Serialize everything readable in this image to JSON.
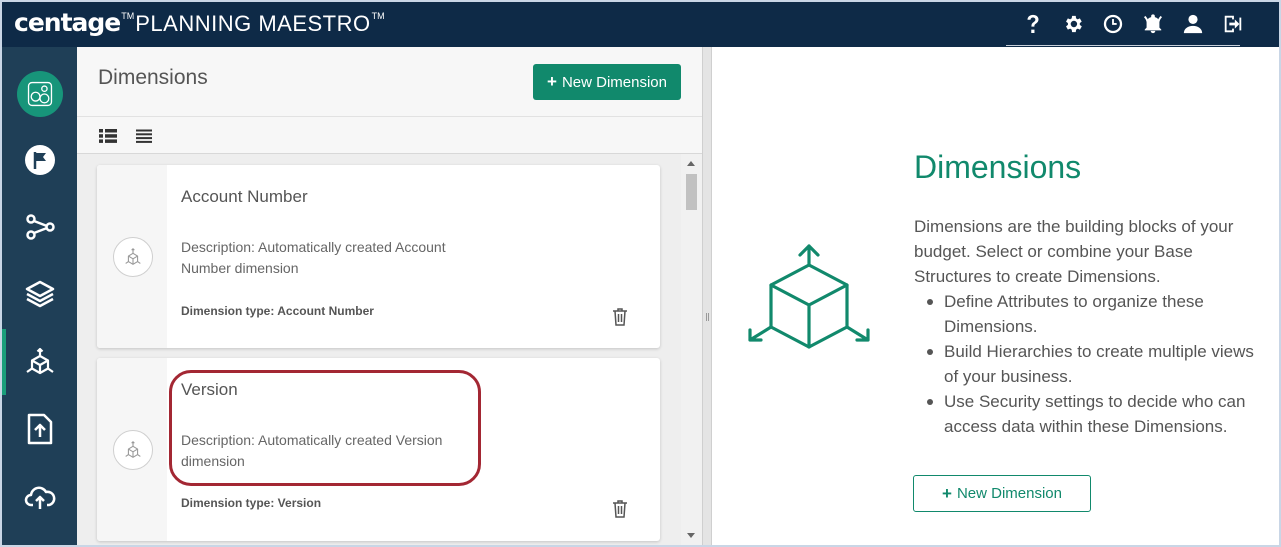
{
  "app": {
    "brand_name": "centage",
    "brand_tm": "TM",
    "product_name": "PLANNING MAESTRO",
    "product_tm": "TM"
  },
  "topbar": {
    "icons": [
      "help-icon",
      "gear-icon",
      "clock-icon",
      "bell-icon",
      "user-icon",
      "logout-icon"
    ]
  },
  "sidebar": {
    "items": [
      {
        "name": "home-logo",
        "icon": "logo-icon"
      },
      {
        "name": "flag",
        "icon": "flag-icon"
      },
      {
        "name": "workflow",
        "icon": "nodes-icon"
      },
      {
        "name": "layers",
        "icon": "layers-icon"
      },
      {
        "name": "dimensions",
        "icon": "cube-icon",
        "active": true
      },
      {
        "name": "upload",
        "icon": "file-upload-icon"
      },
      {
        "name": "cloud-upload",
        "icon": "cloud-upload-icon"
      }
    ]
  },
  "list_panel": {
    "title": "Dimensions",
    "new_button": "New Dimension",
    "new_button_icon": "+",
    "cards": [
      {
        "title": "Account Number",
        "description": "Description: Automatically created Account Number dimension",
        "type": "Dimension type: Account Number"
      },
      {
        "title": "Version",
        "description": "Description: Automatically created Version dimension",
        "type": "Dimension type: Version"
      }
    ]
  },
  "info_panel": {
    "title": "Dimensions",
    "paragraph": "Dimensions are the building blocks of your budget. Select or combine your Base Structures to create Dimensions.",
    "bullets": [
      "Define Attributes to organize these Dimensions.",
      "Build Hierarchies to create multiple views of your business.",
      "Use Security settings to decide who can access data within these Dimensions."
    ],
    "new_button": "New Dimension",
    "new_button_icon": "+"
  },
  "colors": {
    "topbar": "#0e2a47",
    "sidebar": "#1f3f57",
    "accent": "#11896c",
    "highlight": "#a32733"
  }
}
